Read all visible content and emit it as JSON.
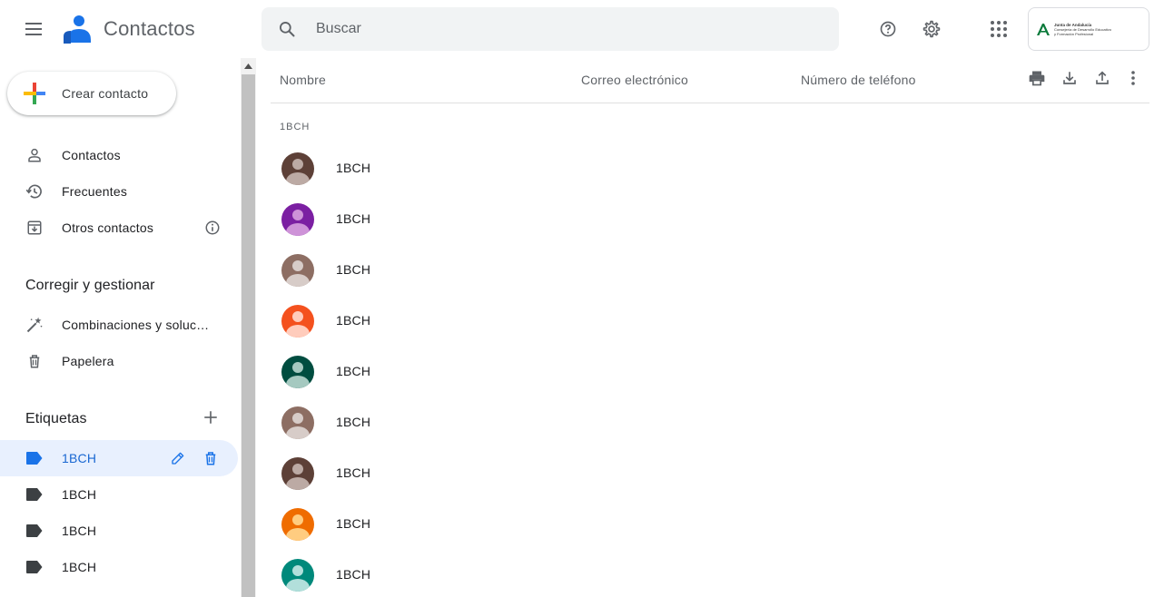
{
  "header": {
    "app_title": "Contactos",
    "search_placeholder": "Buscar",
    "icons": [
      "menu-icon",
      "help-icon",
      "settings-icon",
      "apps-icon"
    ],
    "org": {
      "line1": "Junta de Andalucía",
      "line2": "Consejería de Desarrollo Educativo",
      "line3": "y Formación Profesional"
    }
  },
  "sidebar": {
    "create_label": "Crear contacto",
    "nav": [
      {
        "label": "Contactos",
        "icon": "person-icon"
      },
      {
        "label": "Frecuentes",
        "icon": "history-icon"
      },
      {
        "label": "Otros contactos",
        "icon": "archive-icon"
      }
    ],
    "manage_title": "Corregir y gestionar",
    "manage": [
      {
        "label": "Combinaciones y soluc…",
        "icon": "magic-wand-icon"
      },
      {
        "label": "Papelera",
        "icon": "trash-icon"
      }
    ],
    "labels_title": "Etiquetas",
    "labels": [
      {
        "label": "1BCH",
        "active": true
      },
      {
        "label": "1BCH",
        "active": false
      },
      {
        "label": "1BCH",
        "active": false
      },
      {
        "label": "1BCH",
        "active": false
      }
    ]
  },
  "main": {
    "columns": {
      "name": "Nombre",
      "email": "Correo electrónico",
      "phone": "Número de teléfono"
    },
    "toolbar_icons": [
      "print-icon",
      "download-icon",
      "upload-icon",
      "more-vert-icon"
    ],
    "group_label": "1BCH",
    "contacts": [
      {
        "name": "1BCH",
        "color": "#5d4037",
        "light": "#bcaaa4"
      },
      {
        "name": "1BCH",
        "color": "#7b1fa2",
        "light": "#ce93d8"
      },
      {
        "name": "1BCH",
        "color": "#8d6e63",
        "light": "#d7ccc8"
      },
      {
        "name": "1BCH",
        "color": "#f4511e",
        "light": "#ffccbc"
      },
      {
        "name": "1BCH",
        "color": "#004d40",
        "light": "#a5c9c0"
      },
      {
        "name": "1BCH",
        "color": "#8d6e63",
        "light": "#d7ccc8"
      },
      {
        "name": "1BCH",
        "color": "#5d4037",
        "light": "#bcaaa4"
      },
      {
        "name": "1BCH",
        "color": "#ef6c00",
        "light": "#ffcc80"
      },
      {
        "name": "1BCH",
        "color": "#00897b",
        "light": "#b2dfdb"
      }
    ]
  },
  "colors": {
    "accent": "#1a73e8",
    "active_label_bg": "#e8f0fe",
    "active_label_text": "#1967d2"
  }
}
